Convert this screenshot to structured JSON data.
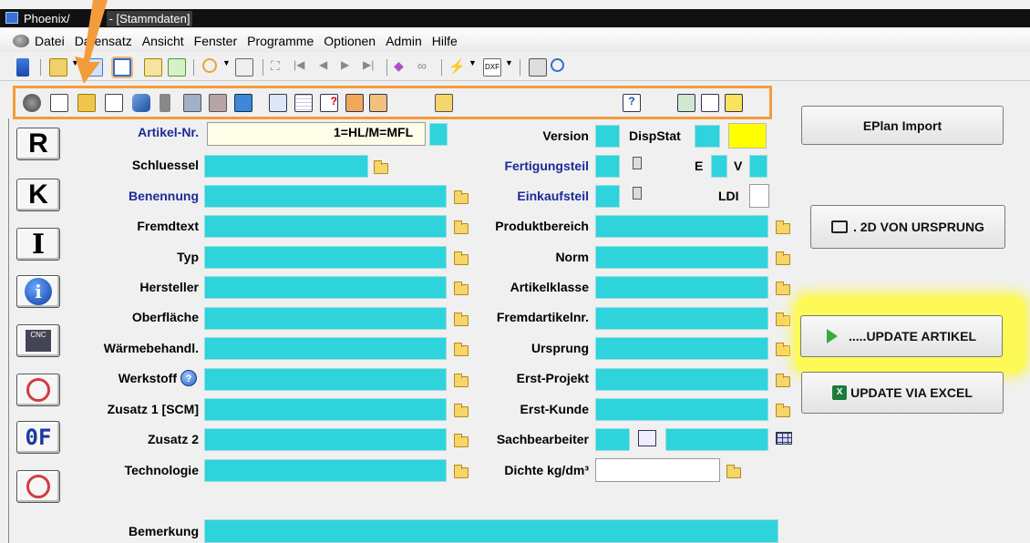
{
  "window": {
    "title_prefix": "Phoenix/",
    "title_suffix": " - [Stammdaten]"
  },
  "menu": [
    "Datei",
    "Datensatz",
    "Ansicht",
    "Fenster",
    "Programme",
    "Optionen",
    "Admin",
    "Hilfe"
  ],
  "left_buttons": [
    "R",
    "K",
    "I",
    "info",
    "CNC",
    "user-gear-play",
    "OF",
    "user-gear-search"
  ],
  "form": {
    "artikel_nr": {
      "label": "Artikel-Nr.",
      "value": "",
      "hint": "1=HL/M=MFL"
    },
    "schluessel": "Schluessel",
    "benennung": "Benennung",
    "fremdtext": "Fremdtext",
    "typ": "Typ",
    "hersteller": "Hersteller",
    "oberflaeche": "Oberfläche",
    "waermebehandl": "Wärmebehandl.",
    "werkstoff": "Werkstoff",
    "zusatz1": "Zusatz 1 [SCM]",
    "zusatz2": "Zusatz 2",
    "technologie": "Technologie",
    "bemerkung": "Bemerkung",
    "version": "Version",
    "dispstat": "DispStat",
    "fertigungsteil": "Fertigungsteil",
    "e": "E",
    "v": "V",
    "einkaufsteil": "Einkaufsteil",
    "ldi": "LDI",
    "produktbereich": "Produktbereich",
    "norm": "Norm",
    "artikelklasse": "Artikelklasse",
    "fremdartikelnr": "Fremdartikelnr.",
    "ursprung": "Ursprung",
    "erst_projekt": "Erst-Projekt",
    "erst_kunde": "Erst-Kunde",
    "sachbearbeiter": "Sachbearbeiter",
    "dichte": "Dichte kg/dm³"
  },
  "right_buttons": {
    "eplan": "EPlan Import",
    "d2": ". 2D VON URSPRUNG",
    "update_artikel": ".....UPDATE ARTIKEL",
    "update_excel": "UPDATE VIA EXCEL"
  },
  "colors": {
    "field": "#2ed3db",
    "highlight": "#fff83c",
    "toolbar_box": "#f39c3c",
    "yellow_field": "#ffff00"
  }
}
